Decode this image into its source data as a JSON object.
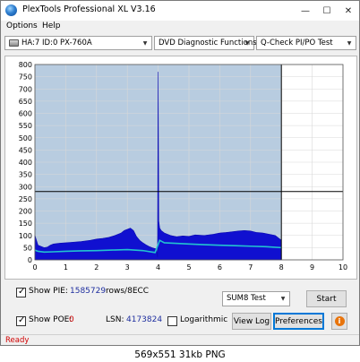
{
  "window": {
    "title": "PlexTools Professional XL V3.16",
    "controls": {
      "minimize": "—",
      "maximize": "☐",
      "close": "✕"
    }
  },
  "menu": {
    "options": "Options",
    "help": "Help"
  },
  "toolbar": {
    "drive": "HA:7 ID:0  PX-760A",
    "function": "DVD Diagnostic Functions",
    "test": "Q-Check PI/PO Test"
  },
  "chart_data": {
    "type": "area",
    "x_range": [
      0,
      10
    ],
    "y_range": [
      0,
      800
    ],
    "x_ticks": [
      "0",
      "1",
      "2",
      "3",
      "4",
      "5",
      "6",
      "7",
      "8",
      "9",
      "10"
    ],
    "y_ticks": [
      "800",
      "750",
      "700",
      "650",
      "600",
      "550",
      "500",
      "450",
      "400",
      "350",
      "300",
      "250",
      "200",
      "150",
      "100",
      "50",
      "0"
    ],
    "grid": true,
    "threshold_line": 280,
    "end_marker_x": 8,
    "colors": {
      "area": "#1010d0",
      "line": "#22c3cf",
      "threshold": "#000000",
      "grid": "#d8d8d8",
      "background_scanned": "#b8cce0"
    },
    "series": [
      {
        "type": "area",
        "x": [
          0,
          0.05,
          0.1,
          0.2,
          0.3,
          0.4,
          0.5,
          0.6,
          0.8,
          1.0,
          1.2,
          1.5,
          1.8,
          2.0,
          2.2,
          2.4,
          2.6,
          2.8,
          2.9,
          3.0,
          3.1,
          3.2,
          3.3,
          3.4,
          3.5,
          3.6,
          3.7,
          3.8,
          3.9,
          3.95,
          3.98,
          4.0,
          4.02,
          4.05,
          4.1,
          4.2,
          4.4,
          4.6,
          4.8,
          5.0,
          5.2,
          5.5,
          5.8,
          6.0,
          6.2,
          6.4,
          6.6,
          6.8,
          7.0,
          7.2,
          7.4,
          7.6,
          7.8,
          7.9,
          8.0
        ],
        "values": [
          100,
          80,
          60,
          55,
          50,
          52,
          60,
          65,
          68,
          70,
          72,
          75,
          80,
          85,
          88,
          92,
          100,
          110,
          120,
          125,
          130,
          120,
          95,
          80,
          70,
          62,
          55,
          50,
          46,
          45,
          10,
          770,
          160,
          130,
          120,
          110,
          100,
          95,
          98,
          96,
          102,
          100,
          105,
          110,
          112,
          115,
          118,
          120,
          118,
          112,
          110,
          105,
          100,
          90,
          80
        ]
      },
      {
        "type": "line",
        "x": [
          0,
          0.1,
          0.3,
          0.6,
          1.0,
          1.5,
          2.0,
          2.5,
          3.0,
          3.5,
          3.9,
          4.05,
          4.2,
          5.0,
          5.5,
          6.0,
          6.5,
          7.0,
          7.5,
          8.0
        ],
        "values": [
          40,
          35,
          32,
          33,
          35,
          37,
          38,
          40,
          42,
          38,
          30,
          80,
          70,
          65,
          62,
          60,
          58,
          56,
          54,
          50
        ]
      }
    ]
  },
  "bottom": {
    "show_pie_label": "Show PIE:",
    "pie_value": "1585729",
    "pie_unit": "rows/8ECC",
    "show_poe_label": "Show POE:",
    "poe_value": "0",
    "lsn_label": "LSN:",
    "lsn_value": "4173824",
    "logarithmic_label": "Logarithmic",
    "sum_select": "SUM8 Test",
    "start_button": "Start",
    "view_log_button": "View Log",
    "preferences_button": "Preferences",
    "info_glyph": "i"
  },
  "status": {
    "text": "Ready"
  },
  "caption": "569x551  31kb  PNG"
}
